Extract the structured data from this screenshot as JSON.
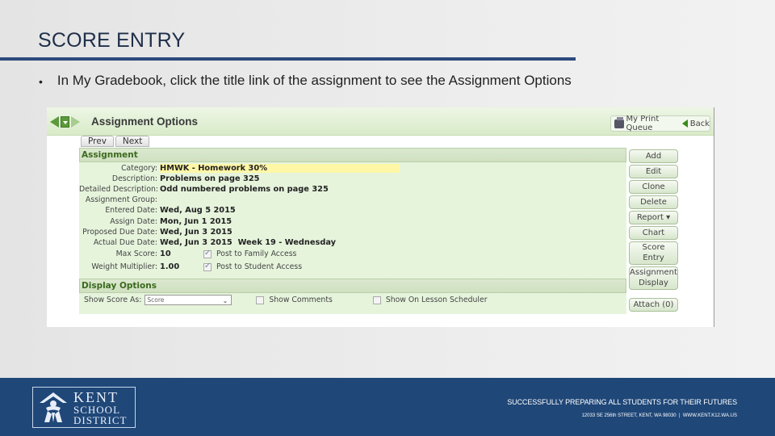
{
  "slide": {
    "title": "SCORE ENTRY",
    "bullet": "In My Gradebook, click the title link of the assignment to see the Assignment Options",
    "accent_color": "#2c4a7c"
  },
  "panel": {
    "title": "Assignment Options",
    "print_queue_label": "My Print Queue",
    "back_label": "Back",
    "prev_label": "Prev",
    "next_label": "Next",
    "assignment_section": "Assignment",
    "fields": [
      {
        "label": "Category:",
        "value": "HMWK - Homework 30%"
      },
      {
        "label": "Description:",
        "value": "Problems on page 325"
      },
      {
        "label": "Detailed Description:",
        "value": "Odd numbered problems on page 325"
      },
      {
        "label": "Assignment Group:",
        "value": ""
      },
      {
        "label": "Entered Date:",
        "value": "Wed, Aug 5 2015"
      },
      {
        "label": "Assign Date:",
        "value": "Mon, Jun 1 2015"
      },
      {
        "label": "Proposed Due Date:",
        "value": "Wed, Jun 3 2015"
      },
      {
        "label": "Actual Due Date:",
        "value": "Wed, Jun 3 2015  Week 19 - Wednesday"
      },
      {
        "label": "Max Score:",
        "value": "10"
      },
      {
        "label": "Weight Multiplier:",
        "value": "1.00"
      }
    ],
    "post_family": {
      "label": "Post to Family Access",
      "checked": true
    },
    "post_student": {
      "label": "Post to Student Access",
      "checked": true
    },
    "display_section": "Display Options",
    "show_score_label": "Show Score As:",
    "show_score_value": "Score",
    "show_comments": {
      "label": "Show Comments",
      "checked": false
    },
    "show_lesson": {
      "label": "Show On Lesson Scheduler",
      "checked": false
    },
    "buttons": {
      "add": "Add",
      "edit": "Edit",
      "clone": "Clone",
      "delete": "Delete",
      "report": "Report ▾",
      "chart": "Chart",
      "score_entry_1": "Score",
      "score_entry_2": "Entry",
      "assignment_display_1": "Assignment",
      "assignment_display_2": "Display",
      "attach": "Attach (0)"
    }
  },
  "footer": {
    "logo_line1": "KENT",
    "logo_line2": "SCHOOL",
    "logo_line3": "DISTRICT",
    "tagline": "SUCCESSFULLY PREPARING ALL STUDENTS FOR THEIR FUTURES",
    "address": "12033 SE 256th STREET, KENT, WA 98030  |  WWW.KENT.K12.WA.US",
    "background": "#1f4778"
  }
}
